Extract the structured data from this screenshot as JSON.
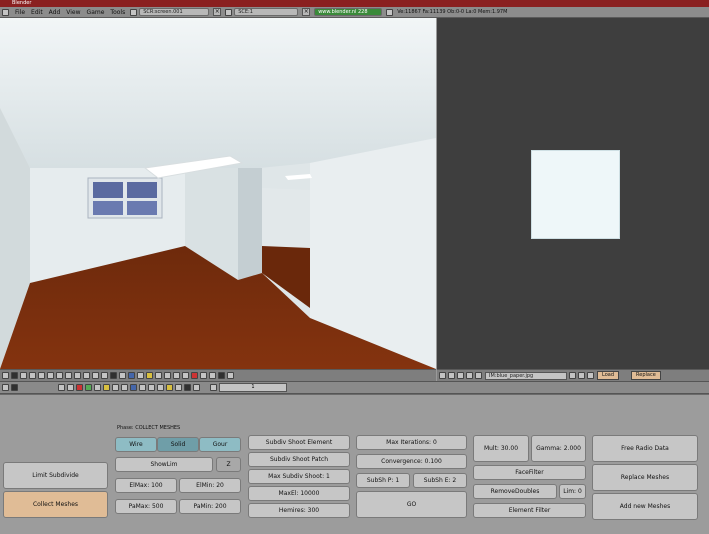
{
  "title": "Blender",
  "menu": [
    "File",
    "Edit",
    "Add",
    "View",
    "Game",
    "Tools"
  ],
  "screen_field": "SCR:screen.001",
  "scene_field": "SCE:1",
  "url": "www.blender.nl 228",
  "stats": "Ve:11867 Fa:11139 Ob:0-0 La:0 Mem:1.97M",
  "image_view": {
    "filename": "IM:blue_paper.jpg",
    "load_label": "Load",
    "replace_label": "Replace"
  },
  "frame_number": "1",
  "radio": {
    "phase": "Phase: COLLECT MESHES",
    "display_buttons": [
      "Wire",
      "Solid",
      "Gour"
    ],
    "show_lim": "ShowLim",
    "z_label": "Z",
    "limit_subdivide": "Limit Subdivide",
    "collect_meshes": "Collect Meshes",
    "elmax": "ElMax: 100",
    "elmin": "ElMin: 20",
    "pamax": "PaMax: 500",
    "pamin": "PaMin: 200",
    "subdiv_shoot_element": "Subdiv Shoot Element",
    "subdiv_shoot_patch": "Subdiv Shoot Patch",
    "max_subdiv_shoot": "Max Subdiv Shoot: 1",
    "max_el": "MaxEl: 10000",
    "hemires": "Hemires: 300",
    "max_iterations": "Max Iterations: 0",
    "convergence": "Convergence: 0.100",
    "subsh_p": "SubSh P: 1",
    "subsh_e": "SubSh E: 2",
    "go": "GO",
    "mult": "Mult: 30.00",
    "gamma": "Gamma: 2.000",
    "face_filter": "FaceFilter",
    "remove_doubles": "RemoveDoubles",
    "lim": "Lim: 0",
    "element_filter": "Element Filter",
    "free_radio_data": "Free Radio Data",
    "replace_meshes": "Replace Meshes",
    "add_new_meshes": "Add new Meshes"
  },
  "colors": {
    "floor": "#7a2d10",
    "wall": "#e8eef0",
    "image_bg": "#3e3e3e",
    "teal_button": "#8ebcc4",
    "orange_button": "#e0bc96"
  }
}
